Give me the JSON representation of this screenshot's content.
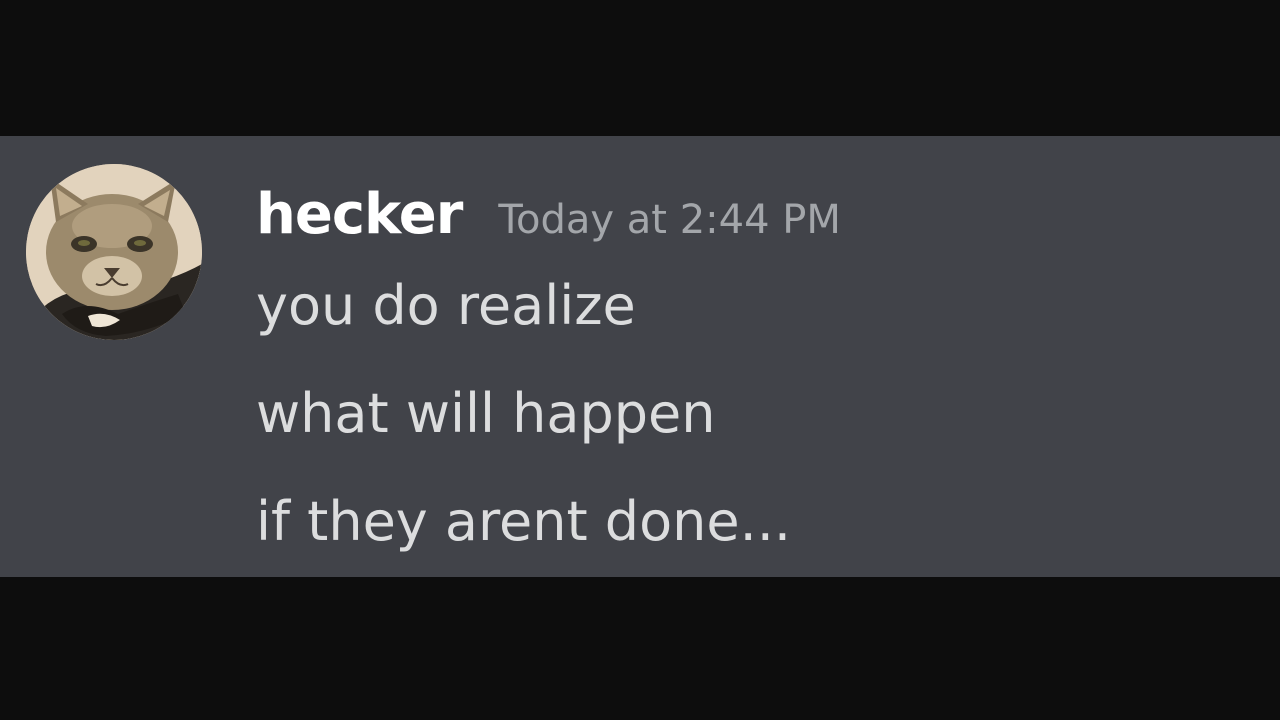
{
  "message": {
    "avatar_icon": "cat-avatar-icon",
    "username": "hecker",
    "timestamp": "Today at 2:44 PM",
    "lines": [
      "you do realize",
      "what will happen",
      "if they arent done..."
    ]
  },
  "colors": {
    "background": "#414349",
    "letterbox": "#0d0d0d",
    "username": "#ffffff",
    "timestamp": "#a3a6aa",
    "message_text": "#dcddde"
  }
}
